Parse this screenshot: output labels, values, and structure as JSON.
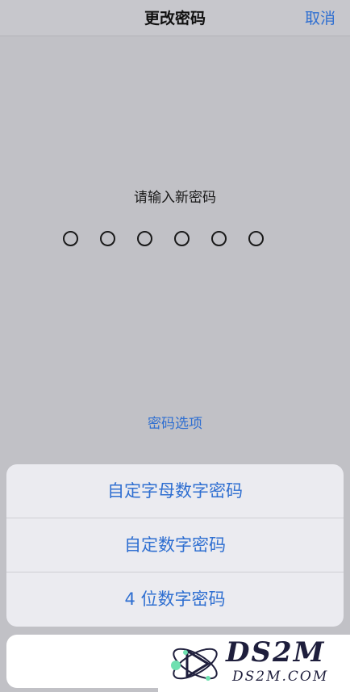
{
  "nav": {
    "title": "更改密码",
    "cancel_label": "取消"
  },
  "prompt": {
    "text": "请输入新密码",
    "digit_count": 6
  },
  "options_link": "密码选项",
  "action_sheet": {
    "items": [
      {
        "label": "自定字母数字密码"
      },
      {
        "label": "自定数字密码"
      },
      {
        "label": "4 位数字密码"
      }
    ]
  },
  "watermark": {
    "brand": "DS2M",
    "domain": "DS2M.COM"
  },
  "colors": {
    "accent": "#2f6fd1",
    "background": "#c1c1c6",
    "sheet": "#ebebf0"
  }
}
